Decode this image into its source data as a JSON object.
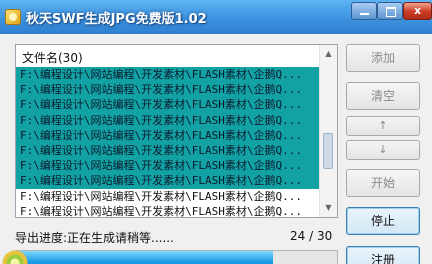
{
  "window": {
    "title": "秋天SWF生成JPG免费版1.02"
  },
  "titlebar": {
    "minimize_icon": "minimize-icon",
    "maximize_icon": "maximize-icon",
    "close_glyph": "x"
  },
  "list": {
    "header": "文件名(30)",
    "rows": [
      {
        "text": "F:\\编程设计\\网站编程\\开发素材\\FLASH素材\\企鹅Q...",
        "selected": true
      },
      {
        "text": "F:\\编程设计\\网站编程\\开发素材\\FLASH素材\\企鹅Q...",
        "selected": true
      },
      {
        "text": "F:\\编程设计\\网站编程\\开发素材\\FLASH素材\\企鹅Q...",
        "selected": true
      },
      {
        "text": "F:\\编程设计\\网站编程\\开发素材\\FLASH素材\\企鹅Q...",
        "selected": true
      },
      {
        "text": "F:\\编程设计\\网站编程\\开发素材\\FLASH素材\\企鹅Q...",
        "selected": true
      },
      {
        "text": "F:\\编程设计\\网站编程\\开发素材\\FLASH素材\\企鹅Q...",
        "selected": true
      },
      {
        "text": "F:\\编程设计\\网站编程\\开发素材\\FLASH素材\\企鹅Q...",
        "selected": true
      },
      {
        "text": "F:\\编程设计\\网站编程\\开发素材\\FLASH素材\\企鹅Q...",
        "selected": true
      },
      {
        "text": "F:\\编程设计\\网站编程\\开发素材\\FLASH素材\\企鹅Q...",
        "selected": false
      },
      {
        "text": "F:\\编程设计\\网站编程\\开发素材\\FLASH素材\\企鹅Q...",
        "selected": false
      }
    ]
  },
  "buttons": {
    "add": "添加",
    "clear": "清空",
    "up": "↑",
    "down": "↓",
    "start": "开始",
    "stop": "停止",
    "register": "注册"
  },
  "status": {
    "progress_text": "导出进度:正在生成请稍等......",
    "count": "24 / 30",
    "progress_fraction": 0.8
  },
  "colors": {
    "selection": "#12a2a4",
    "progress": "#1b9be6",
    "titlebar": "#3d93e0"
  }
}
